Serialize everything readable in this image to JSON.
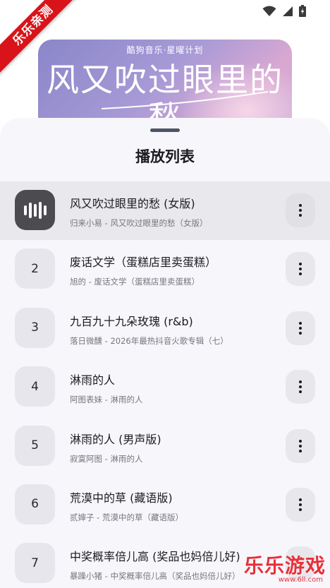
{
  "status_bar": {
    "icons": [
      "wifi-icon",
      "signal-icon",
      "battery-icon"
    ]
  },
  "watermark": {
    "corner_text": "乐乐亲测",
    "bottom_title": "乐乐游戏",
    "bottom_url": "www.6ll.com"
  },
  "album": {
    "brand": "酷狗音乐·星曜计划",
    "title": "风又吹过眼里的愁"
  },
  "playlist": {
    "title": "播放列表",
    "items": [
      {
        "index": "",
        "title": "风又吹过眼里的愁 (女版)",
        "subtitle": "归来小易 - 风又吹过眼里的愁（女版）",
        "playing": true
      },
      {
        "index": "2",
        "title": "废话文学（蛋糕店里卖蛋糕）",
        "subtitle": "旭的 - 废话文学（蛋糕店里卖蛋糕）",
        "playing": false
      },
      {
        "index": "3",
        "title": "九百九十九朵玫瑰 (r&b)",
        "subtitle": "落日微醺 - 2026年最热抖音火歌专辑（七）",
        "playing": false
      },
      {
        "index": "4",
        "title": "淋雨的人",
        "subtitle": "阿图表妹 - 淋雨的人",
        "playing": false
      },
      {
        "index": "5",
        "title": "淋雨的人 (男声版)",
        "subtitle": "寂寞阿图 - 淋雨的人",
        "playing": false
      },
      {
        "index": "6",
        "title": "荒漠中的草 (藏语版)",
        "subtitle": "贰婶子 - 荒漠中的草（藏语版）",
        "playing": false
      },
      {
        "index": "7",
        "title": "中奖概率倍儿高 (奖品也妈倍儿好)",
        "subtitle": "暴躁小猪 - 中奖概率倍儿高（奖品也妈倍儿好）",
        "playing": false
      }
    ]
  },
  "colors": {
    "sheet_bg": "#f7f6fb",
    "active_row_bg": "#e9e8ec",
    "playing_tile": "#4b4b50",
    "watermark_red": "#d8141a"
  }
}
